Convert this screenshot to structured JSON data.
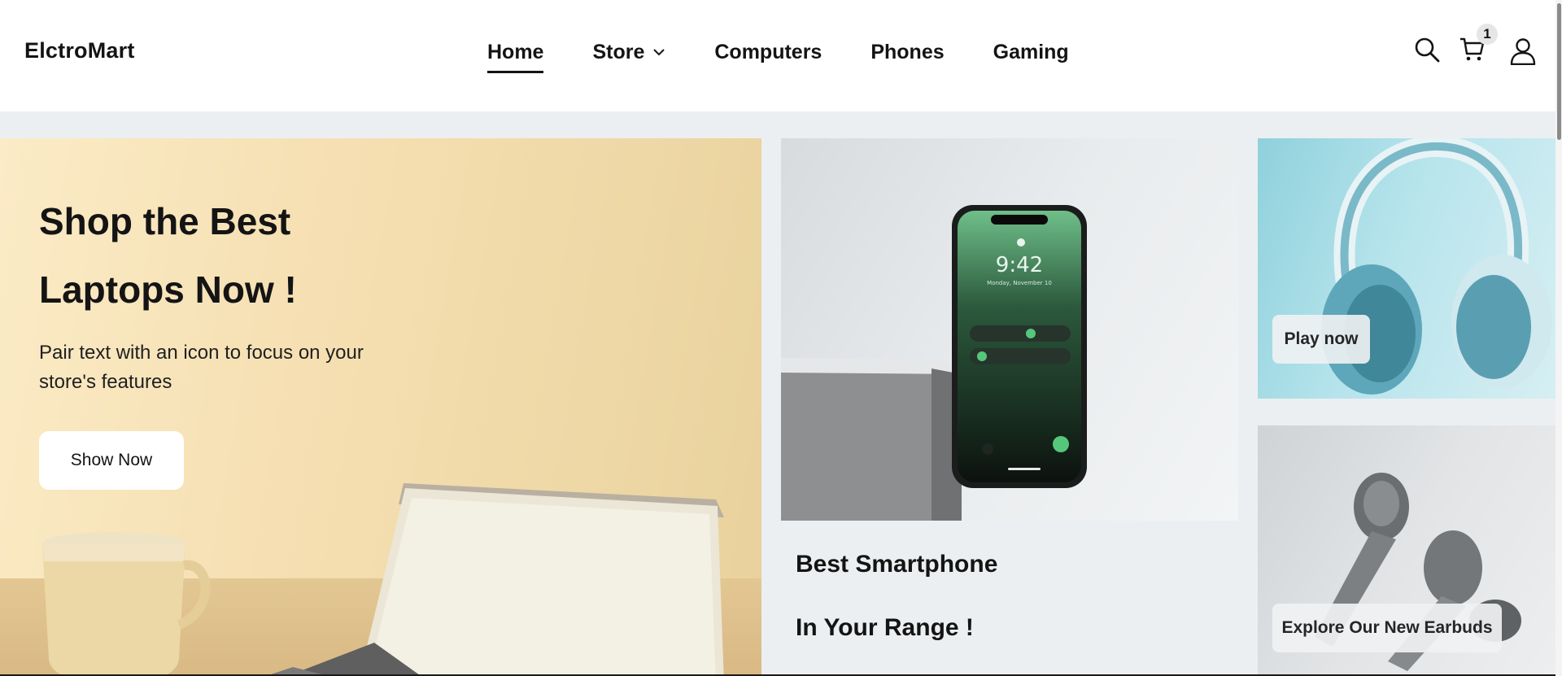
{
  "header": {
    "logo": "ElctroMart",
    "nav": [
      {
        "label": "Home",
        "active": true
      },
      {
        "label": "Store",
        "has_dropdown": true
      },
      {
        "label": "Computers"
      },
      {
        "label": "Phones"
      },
      {
        "label": "Gaming"
      }
    ],
    "icons": [
      "search-icon",
      "cart-icon",
      "account-icon"
    ],
    "cart_count": "1"
  },
  "hero": {
    "laptop": {
      "title_line1": "Shop the Best",
      "title_line2": "Laptops Now !",
      "description": "Pair text with an icon to focus on your store's features",
      "button": "Show Now"
    },
    "phone": {
      "caption_line1": "Best Smartphone",
      "caption_line2": "In Your Range !",
      "screen_time": "9:42",
      "screen_date": "Monday, November 10"
    },
    "headphones": {
      "button": "Play now"
    },
    "earbuds": {
      "button": "Explore Our New Earbuds"
    }
  },
  "colors": {
    "text": "#141414",
    "content_bg": "#eceff1",
    "laptop_banner": "#f5deb0",
    "headphones_banner": "#b7e4ec",
    "earbuds_banner": "#e2e4e6"
  }
}
